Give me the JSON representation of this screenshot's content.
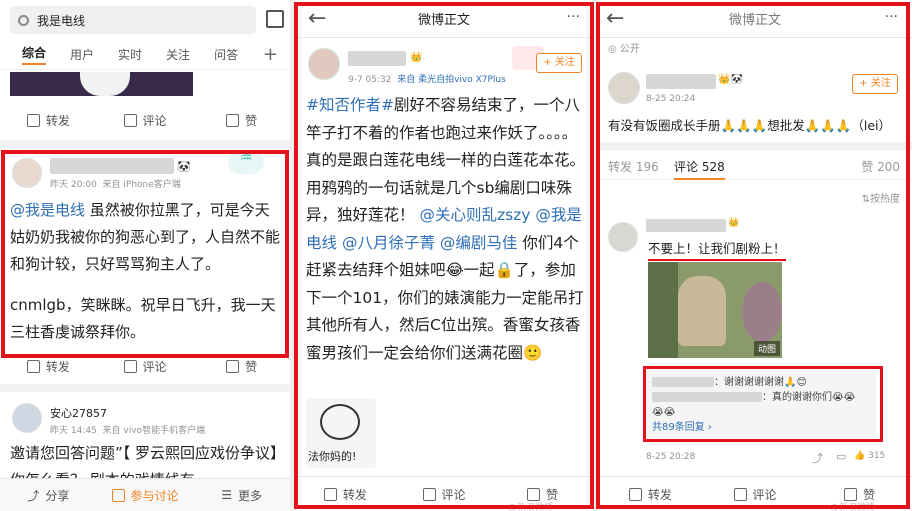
{
  "panel1": {
    "search": {
      "value": "我是电线"
    },
    "tabs": [
      "综合",
      "用户",
      "实时",
      "关注",
      "问答"
    ],
    "plus": "+",
    "actions1": {
      "repost": "转发",
      "comment": "评论",
      "like": "赞"
    },
    "post1": {
      "time": "昨天 20:00",
      "source": "来自 iPhone客户端",
      "mention": "@我是电线",
      "text": " 虽然被你拉黑了，可是今天姑奶奶我被你的狗恶心到了，人自然不能和狗计较，只好骂骂狗主人了。",
      "text2": "cnmlgb，笑眯眯。祝早日飞升，我一天三柱香虔诚祭拜你。"
    },
    "actions2": {
      "repost": "转发",
      "comment": "评论",
      "like": "赞"
    },
    "post2": {
      "user": "安心27857",
      "time": "昨天 14:45",
      "source": "来自 vivo智能手机客户端",
      "text": "邀请您回答问题”【 罗云熙回应戏份争议】你怎么看？ 剧本的戏情线有…"
    },
    "bottom": {
      "share": "分享",
      "discuss": "参与讨论",
      "more": "更多"
    }
  },
  "panel2": {
    "header": {
      "title": "微博正文",
      "more": "···"
    },
    "follow": "+ 关注",
    "meta": {
      "time": "9-7 05:32",
      "source": "来自 柔光自拍vivo X7Plus"
    },
    "body": {
      "tag": "#知否作者#",
      "t1": "剧好不容易结束了，一个八竿子打不着的作者也跑过来作妖了。。。。真的是跟白莲花电线一样的白莲花本花。用鸦鸦的一句话就是几个sb编剧口味殊异，独好莲花！",
      "m1": "@关心则乱zszy",
      "m2": "@我是电线",
      "m3": "@八月徐子菁",
      "m4": "@编剧马佳",
      "t2": " 你们4个赶紧去结拜个姐妹吧😂一起🔒了，参加下一个101，你们的婊演能力一定能吊打其他所有人，然后C位出殡。香蜜女孩香蜜男孩们一定会给你们送满花圈🙂"
    },
    "sticker_text": "法你妈的!",
    "bottom": {
      "repost": "转发",
      "comment": "评论",
      "like": "赞"
    },
    "watermark": "@新浪微博"
  },
  "panel3": {
    "header": {
      "title": "微博正文",
      "more": "···"
    },
    "public": "公开",
    "follow": "+ 关注",
    "time": "8-25 20:24",
    "post_text": "有没有饭圈成长手册🙏🙏🙏想批发🙏🙏🙏（lei）",
    "counts": {
      "repost": "转发 196",
      "comment": "评论 528",
      "like": "赞 200"
    },
    "sort": "按热度",
    "comment": {
      "text": "不要上！让我们剧粉上！",
      "gif": "动图",
      "reply1": "：谢谢谢谢谢谢🙏😊",
      "reply2": "：真的谢谢你们😭😭",
      "reply3": "😭😭",
      "more": "共89条回复 ›",
      "time": "8-25 20:28",
      "likes": "315"
    },
    "bottom": {
      "repost": "转发",
      "comment": "评论",
      "like": "赞"
    },
    "watermark": "@新浪微博"
  },
  "colors": {
    "frame": "#e3121b",
    "link": "#2f6fb5",
    "accent": "#f28322"
  }
}
